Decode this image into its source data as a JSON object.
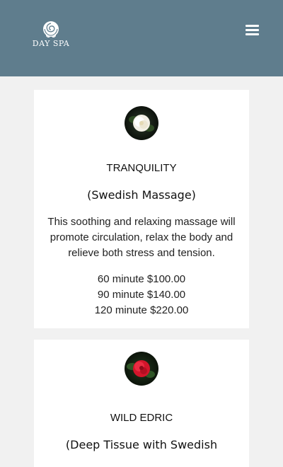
{
  "header": {
    "logo_text": "DAY SPA",
    "logo_icon": "rose-icon",
    "menu_icon": "hamburger-menu-icon",
    "background_color": "#5f7d8d"
  },
  "cards": [
    {
      "image": "white-rose-icon",
      "title": "TRANQUILITY",
      "subtitle": "(Swedish Massage)",
      "description": "This soothing and relaxing massage will promote circulation, relax the body and relieve both stress and tension.",
      "prices": [
        "60 minute $100.00",
        "90 minute $140.00",
        "120 minute $220.00"
      ]
    },
    {
      "image": "red-rose-icon",
      "title": "WILD EDRIC",
      "subtitle": "(Deep Tissue with Swedish"
    }
  ]
}
